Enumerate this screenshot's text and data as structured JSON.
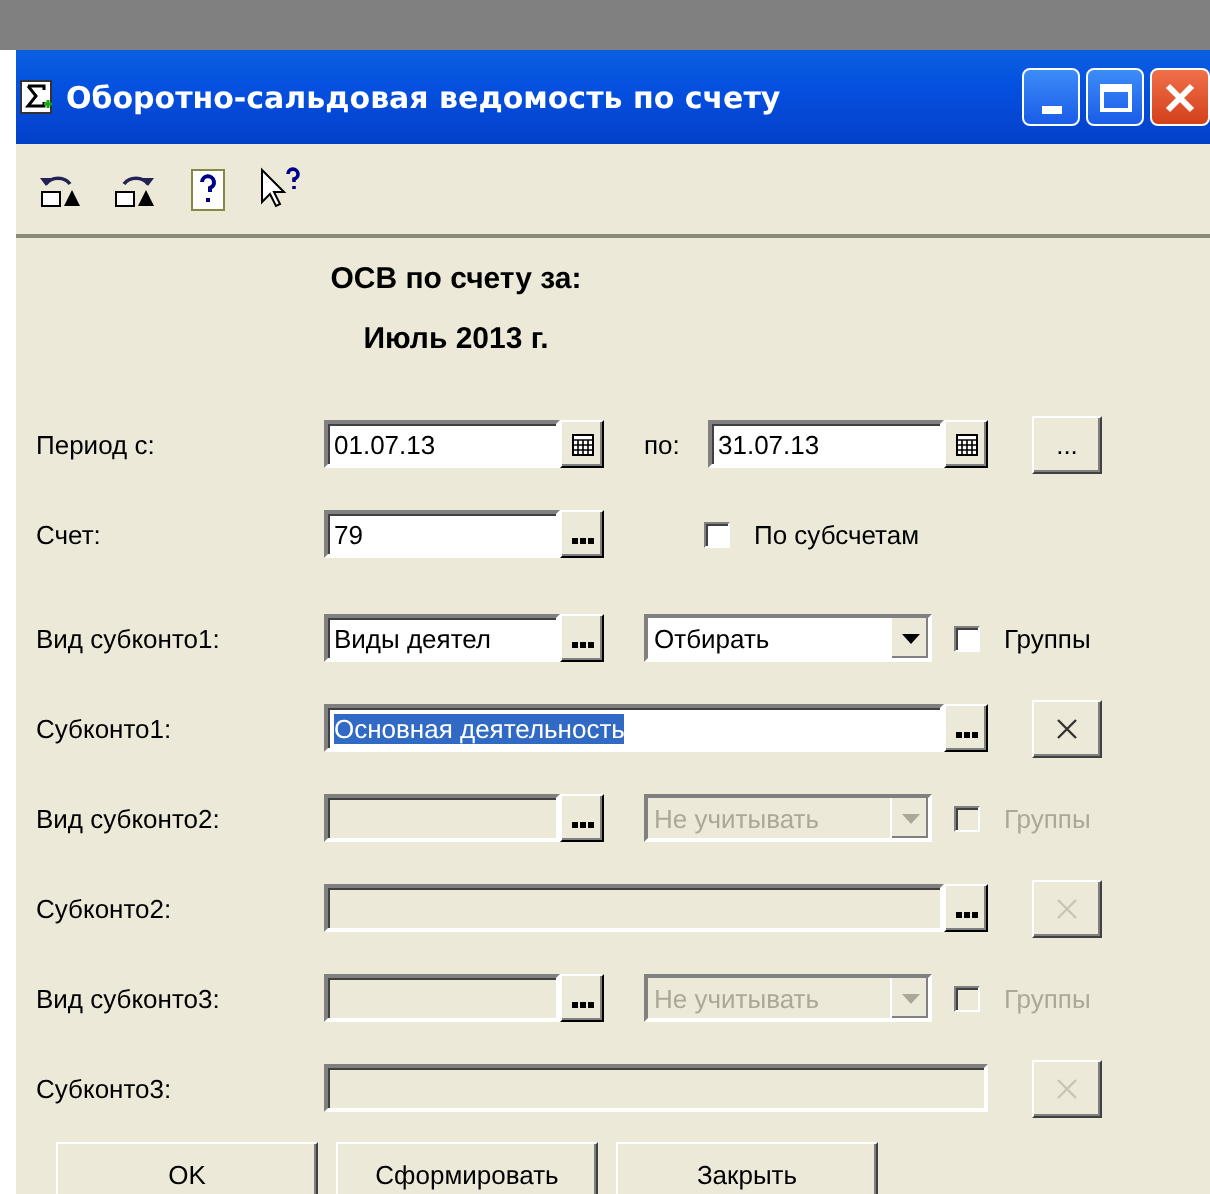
{
  "window": {
    "title": "Оборотно-сальдовая ведомость по счету"
  },
  "heading": [
    "ОСВ по счету за:",
    "Июль 2013 г."
  ],
  "period": {
    "label": "Период с:",
    "from": "01.07.13",
    "to_label": "по:",
    "to": "31.07.13",
    "more": "..."
  },
  "account": {
    "label": "Счет:",
    "value": "79",
    "checkbox": {
      "label": "По субсчетам",
      "checked": false
    }
  },
  "subkonto": [
    {
      "kind_label": "Вид субконто1:",
      "kind_value": "Виды деятел",
      "mode": "Отбирать",
      "group_label": "Группы",
      "group_checked": false,
      "label": "Субконто1:",
      "value": "Основная деятельность",
      "highlighted": true,
      "picker": true,
      "disabled": false
    },
    {
      "kind_label": "Вид субконто2:",
      "mode": "Не учитывать",
      "group_label": "Группы",
      "group_checked": false,
      "label": "Субконто2:",
      "picker": true,
      "disabled": true
    },
    {
      "kind_label": "Вид субконто3:",
      "mode": "Не учитывать",
      "group_label": "Группы",
      "group_checked": false,
      "label": "Субконто3:",
      "picker": false,
      "disabled": true
    }
  ],
  "buttons": [
    "OK",
    "Сформировать",
    "Закрыть"
  ]
}
